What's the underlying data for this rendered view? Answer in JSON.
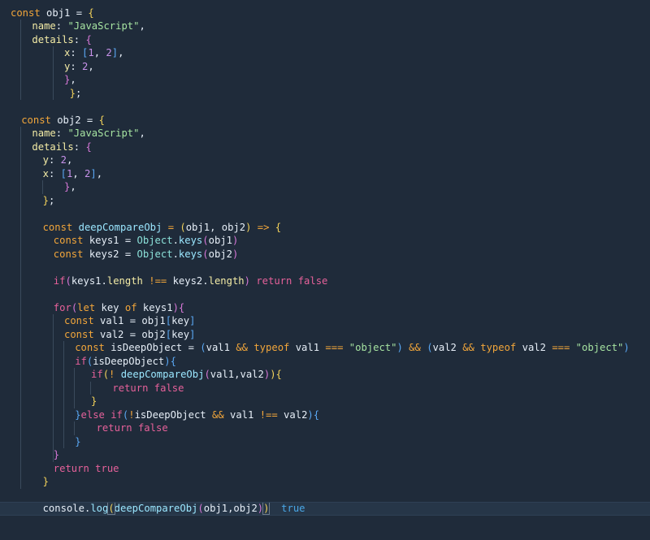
{
  "colors": {
    "background": "#1f2b3a",
    "current_line": "#263648"
  },
  "lines": [
    {
      "indent": 0,
      "guides": [],
      "tokens": [
        [
          "const",
          "kw"
        ],
        [
          " obj1 = ",
          "id"
        ],
        [
          "{",
          "brace"
        ]
      ]
    },
    {
      "indent": 2,
      "guides": [
        1
      ],
      "tokens": [
        [
          "name",
          "prop"
        ],
        [
          ": ",
          "punc"
        ],
        [
          "\"JavaScript\"",
          "str"
        ],
        [
          ",",
          "punc"
        ]
      ]
    },
    {
      "indent": 2,
      "guides": [
        1
      ],
      "tokens": [
        [
          "details",
          "prop"
        ],
        [
          ": ",
          "punc"
        ],
        [
          "{",
          "brace2"
        ]
      ]
    },
    {
      "indent": 5,
      "guides": [
        1,
        4
      ],
      "tokens": [
        [
          "x",
          "prop"
        ],
        [
          ": ",
          "punc"
        ],
        [
          "[",
          "brace3"
        ],
        [
          "1",
          "num"
        ],
        [
          ", ",
          "punc"
        ],
        [
          "2",
          "num"
        ],
        [
          "]",
          "brace3"
        ],
        [
          ",",
          "punc"
        ]
      ]
    },
    {
      "indent": 5,
      "guides": [
        1,
        4
      ],
      "tokens": [
        [
          "y",
          "prop"
        ],
        [
          ": ",
          "punc"
        ],
        [
          "2",
          "num"
        ],
        [
          ",",
          "punc"
        ]
      ]
    },
    {
      "indent": 5,
      "guides": [
        1,
        4
      ],
      "tokens": [
        [
          "}",
          "brace2"
        ],
        [
          ",",
          "punc"
        ]
      ]
    },
    {
      "indent": 5.5,
      "guides": [
        1,
        4
      ],
      "tokens": [
        [
          "}",
          "brace"
        ],
        [
          ";",
          "punc"
        ]
      ]
    },
    {
      "indent": 0,
      "guides": [],
      "tokens": []
    },
    {
      "indent": 1,
      "guides": [],
      "tokens": [
        [
          "const",
          "kw"
        ],
        [
          " obj2 = ",
          "id"
        ],
        [
          "{",
          "brace"
        ]
      ]
    },
    {
      "indent": 2,
      "guides": [
        1
      ],
      "tokens": [
        [
          "name",
          "prop"
        ],
        [
          ": ",
          "punc"
        ],
        [
          "\"JavaScript\"",
          "str"
        ],
        [
          ",",
          "punc"
        ]
      ]
    },
    {
      "indent": 2,
      "guides": [
        1
      ],
      "tokens": [
        [
          "details",
          "prop"
        ],
        [
          ": ",
          "punc"
        ],
        [
          "{",
          "brace2"
        ]
      ]
    },
    {
      "indent": 3,
      "guides": [
        1
      ],
      "tokens": [
        [
          "y",
          "prop"
        ],
        [
          ": ",
          "punc"
        ],
        [
          "2",
          "num"
        ],
        [
          ",",
          "punc"
        ]
      ]
    },
    {
      "indent": 3,
      "guides": [
        1
      ],
      "tokens": [
        [
          "x",
          "prop"
        ],
        [
          ": ",
          "punc"
        ],
        [
          "[",
          "brace3"
        ],
        [
          "1",
          "num"
        ],
        [
          ", ",
          "punc"
        ],
        [
          "2",
          "num"
        ],
        [
          "]",
          "brace3"
        ],
        [
          ",",
          "punc"
        ]
      ]
    },
    {
      "indent": 5,
      "guides": [
        1,
        3
      ],
      "tokens": [
        [
          "}",
          "brace2"
        ],
        [
          ",",
          "punc"
        ]
      ]
    },
    {
      "indent": 3,
      "guides": [
        1
      ],
      "tokens": [
        [
          "}",
          "brace"
        ],
        [
          ";",
          "punc"
        ]
      ]
    },
    {
      "indent": 0,
      "guides": [
        1
      ],
      "tokens": []
    },
    {
      "indent": 3,
      "guides": [
        1
      ],
      "tokens": [
        [
          "const",
          "kw"
        ],
        [
          " ",
          "id"
        ],
        [
          "deepCompareObj",
          "fn"
        ],
        [
          " = ",
          "op"
        ],
        [
          "(",
          "brace"
        ],
        [
          "obj1, obj2",
          "id"
        ],
        [
          ")",
          "brace"
        ],
        [
          " => ",
          "op"
        ],
        [
          "{",
          "brace"
        ]
      ]
    },
    {
      "indent": 4,
      "guides": [
        1
      ],
      "tokens": [
        [
          "const",
          "kw"
        ],
        [
          " keys1 = ",
          "id"
        ],
        [
          "Object",
          "obj"
        ],
        [
          ".",
          "punc"
        ],
        [
          "keys",
          "fn"
        ],
        [
          "(",
          "brace2"
        ],
        [
          "obj1",
          "id"
        ],
        [
          ")",
          "brace2"
        ]
      ]
    },
    {
      "indent": 4,
      "guides": [
        1
      ],
      "tokens": [
        [
          "const",
          "kw"
        ],
        [
          " keys2 = ",
          "id"
        ],
        [
          "Object",
          "obj"
        ],
        [
          ".",
          "punc"
        ],
        [
          "keys",
          "fn"
        ],
        [
          "(",
          "brace2"
        ],
        [
          "obj2",
          "id"
        ],
        [
          ")",
          "brace2"
        ]
      ]
    },
    {
      "indent": 0,
      "guides": [
        1
      ],
      "tokens": []
    },
    {
      "indent": 4,
      "guides": [
        1
      ],
      "tokens": [
        [
          "if",
          "ctrl"
        ],
        [
          "(",
          "brace2"
        ],
        [
          "keys1.",
          "id"
        ],
        [
          "length",
          "prop"
        ],
        [
          " !== ",
          "op"
        ],
        [
          "keys2.",
          "id"
        ],
        [
          "length",
          "prop"
        ],
        [
          ")",
          "brace2"
        ],
        [
          " return ",
          "ctrl"
        ],
        [
          "false",
          "bool"
        ]
      ]
    },
    {
      "indent": 0,
      "guides": [
        1
      ],
      "tokens": []
    },
    {
      "indent": 4,
      "guides": [
        1
      ],
      "tokens": [
        [
          "for",
          "ctrl"
        ],
        [
          "(",
          "brace2"
        ],
        [
          "let",
          "kw"
        ],
        [
          " key ",
          "id"
        ],
        [
          "of",
          "kw"
        ],
        [
          " keys1",
          "id"
        ],
        [
          ")",
          "brace2"
        ],
        [
          "{",
          "brace2"
        ]
      ]
    },
    {
      "indent": 5,
      "guides": [
        1,
        4
      ],
      "tokens": [
        [
          "const",
          "kw"
        ],
        [
          " val1 = obj1",
          "id"
        ],
        [
          "[",
          "brace3"
        ],
        [
          "key",
          "id"
        ],
        [
          "]",
          "brace3"
        ]
      ]
    },
    {
      "indent": 5,
      "guides": [
        1,
        4
      ],
      "tokens": [
        [
          "const",
          "kw"
        ],
        [
          " val2 = obj2",
          "id"
        ],
        [
          "[",
          "brace3"
        ],
        [
          "key",
          "id"
        ],
        [
          "]",
          "brace3"
        ]
      ]
    },
    {
      "indent": 6,
      "guides": [
        1,
        4,
        5
      ],
      "tokens": [
        [
          "const",
          "kw"
        ],
        [
          " isDeepObject = ",
          "id"
        ],
        [
          "(",
          "brace3"
        ],
        [
          "val1 ",
          "id"
        ],
        [
          "&&",
          "op"
        ],
        [
          " ",
          "id"
        ],
        [
          "typeof",
          "kw"
        ],
        [
          " val1 ",
          "id"
        ],
        [
          "===",
          "op"
        ],
        [
          " ",
          "id"
        ],
        [
          "\"object\"",
          "str"
        ],
        [
          ")",
          "brace3"
        ],
        [
          " ",
          "id"
        ],
        [
          "&&",
          "op"
        ],
        [
          " ",
          "id"
        ],
        [
          "(",
          "brace3"
        ],
        [
          "val2 ",
          "id"
        ],
        [
          "&&",
          "op"
        ],
        [
          " ",
          "id"
        ],
        [
          "typeof",
          "kw"
        ],
        [
          " val2 ",
          "id"
        ],
        [
          "===",
          "op"
        ],
        [
          " ",
          "id"
        ],
        [
          "\"object\"",
          "str"
        ],
        [
          ")",
          "brace3"
        ]
      ]
    },
    {
      "indent": 6,
      "guides": [
        1,
        4,
        5
      ],
      "tokens": [
        [
          "if",
          "ctrl"
        ],
        [
          "(",
          "brace3"
        ],
        [
          "isDeepObject",
          "id"
        ],
        [
          ")",
          "brace3"
        ],
        [
          "{",
          "brace3"
        ]
      ]
    },
    {
      "indent": 7.5,
      "guides": [
        1,
        4,
        5,
        6
      ],
      "tokens": [
        [
          "if",
          "ctrl"
        ],
        [
          "(",
          "brace"
        ],
        [
          "! ",
          "op"
        ],
        [
          "deepCompareObj",
          "fn"
        ],
        [
          "(",
          "brace2"
        ],
        [
          "val1,val2",
          "id"
        ],
        [
          ")",
          "brace2"
        ],
        [
          ")",
          "brace"
        ],
        [
          "{",
          "brace"
        ]
      ]
    },
    {
      "indent": 9.5,
      "guides": [
        1,
        4,
        5,
        6,
        7.5
      ],
      "tokens": [
        [
          "return ",
          "ctrl"
        ],
        [
          "false",
          "bool"
        ]
      ]
    },
    {
      "indent": 7.5,
      "guides": [
        1,
        4,
        5,
        6
      ],
      "tokens": [
        [
          "}",
          "brace"
        ]
      ]
    },
    {
      "indent": 6,
      "guides": [
        1,
        4,
        5
      ],
      "tokens": [
        [
          "}",
          "brace3"
        ],
        [
          "else ",
          "ctrl"
        ],
        [
          "if",
          "ctrl"
        ],
        [
          "(",
          "brace3"
        ],
        [
          "!",
          "op"
        ],
        [
          "isDeepObject ",
          "id"
        ],
        [
          "&&",
          "op"
        ],
        [
          " val1 ",
          "id"
        ],
        [
          "!==",
          "op"
        ],
        [
          " val2",
          "id"
        ],
        [
          ")",
          "brace3"
        ],
        [
          "{",
          "brace3"
        ]
      ]
    },
    {
      "indent": 8,
      "guides": [
        1,
        4,
        5,
        6
      ],
      "tokens": [
        [
          "return ",
          "ctrl"
        ],
        [
          "false",
          "bool"
        ]
      ]
    },
    {
      "indent": 6,
      "guides": [
        1,
        4,
        5
      ],
      "tokens": [
        [
          "}",
          "brace3"
        ]
      ]
    },
    {
      "indent": 4,
      "guides": [
        1,
        4
      ],
      "tokens": [
        [
          "}",
          "brace2"
        ]
      ]
    },
    {
      "indent": 4,
      "guides": [
        1
      ],
      "tokens": [
        [
          "return ",
          "ctrl"
        ],
        [
          "true",
          "bool"
        ]
      ]
    },
    {
      "indent": 3,
      "guides": [
        1
      ],
      "tokens": [
        [
          "}",
          "brace"
        ]
      ]
    },
    {
      "indent": 0,
      "guides": [],
      "tokens": []
    },
    {
      "indent": 3,
      "guides": [],
      "current": true,
      "tokens": [
        [
          "console",
          "id"
        ],
        [
          ".",
          "punc"
        ],
        [
          "log",
          "fn"
        ],
        [
          "(",
          "brace",
          "box"
        ],
        [
          "deepCompareObj",
          "fn"
        ],
        [
          "(",
          "brace2"
        ],
        [
          "obj1,obj2",
          "id"
        ],
        [
          ")",
          "brace2"
        ],
        [
          ")",
          "brace",
          "box"
        ],
        [
          "  ",
          "id"
        ],
        [
          "true",
          "hint"
        ]
      ]
    }
  ]
}
